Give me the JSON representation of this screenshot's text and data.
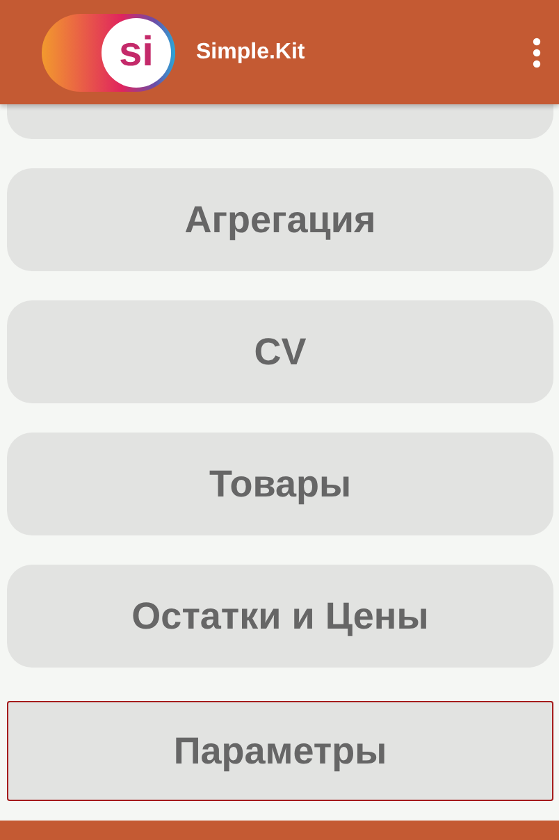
{
  "app_bar": {
    "logo_text": "si",
    "title": "Simple.Kit"
  },
  "menu_items": [
    {
      "selected": false
    },
    {
      "label": "Агрегация",
      "selected": false
    },
    {
      "label": "CV",
      "selected": false
    },
    {
      "label": "Товары",
      "selected": false
    },
    {
      "label": "Остатки и Цены",
      "selected": false
    },
    {
      "label": "Параметры",
      "selected": true
    }
  ]
}
